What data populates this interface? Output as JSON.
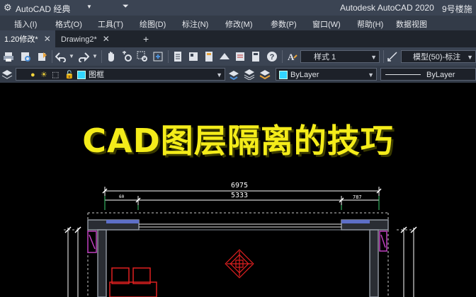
{
  "title_bar": {
    "app_menu": "AutoCAD 经典",
    "app_title": "Autodesk AutoCAD 2020",
    "file_title": "9号楼施"
  },
  "menu": {
    "items": [
      "插入(I)",
      "格式(O)",
      "工具(T)",
      "绘图(D)",
      "标注(N)",
      "修改(M)",
      "参数(P)",
      "窗口(W)",
      "帮助(H)",
      "数据视图"
    ]
  },
  "tabs": {
    "items": [
      {
        "label": "1.20修改*",
        "active": true
      },
      {
        "label": "Drawing2*",
        "active": false
      }
    ],
    "close": "✕",
    "add": "+"
  },
  "toolbar1": {
    "text_style": "样式 1",
    "dim_style": "模型(50)-标注"
  },
  "toolbar2": {
    "layer": "图框",
    "color": "ByLayer",
    "linetype": "ByLayer"
  },
  "canvas": {
    "banner": "CAD图层隔离的技巧",
    "dim_overall": "6975",
    "dim_inner": "5333",
    "dim_left": "60",
    "dim_right": "787"
  },
  "colors": {
    "banner": "#f4ec1a",
    "wall": "#7a7f88",
    "column": "#c040c0",
    "red_object": "#e02020",
    "dimension": "#ffffff"
  }
}
